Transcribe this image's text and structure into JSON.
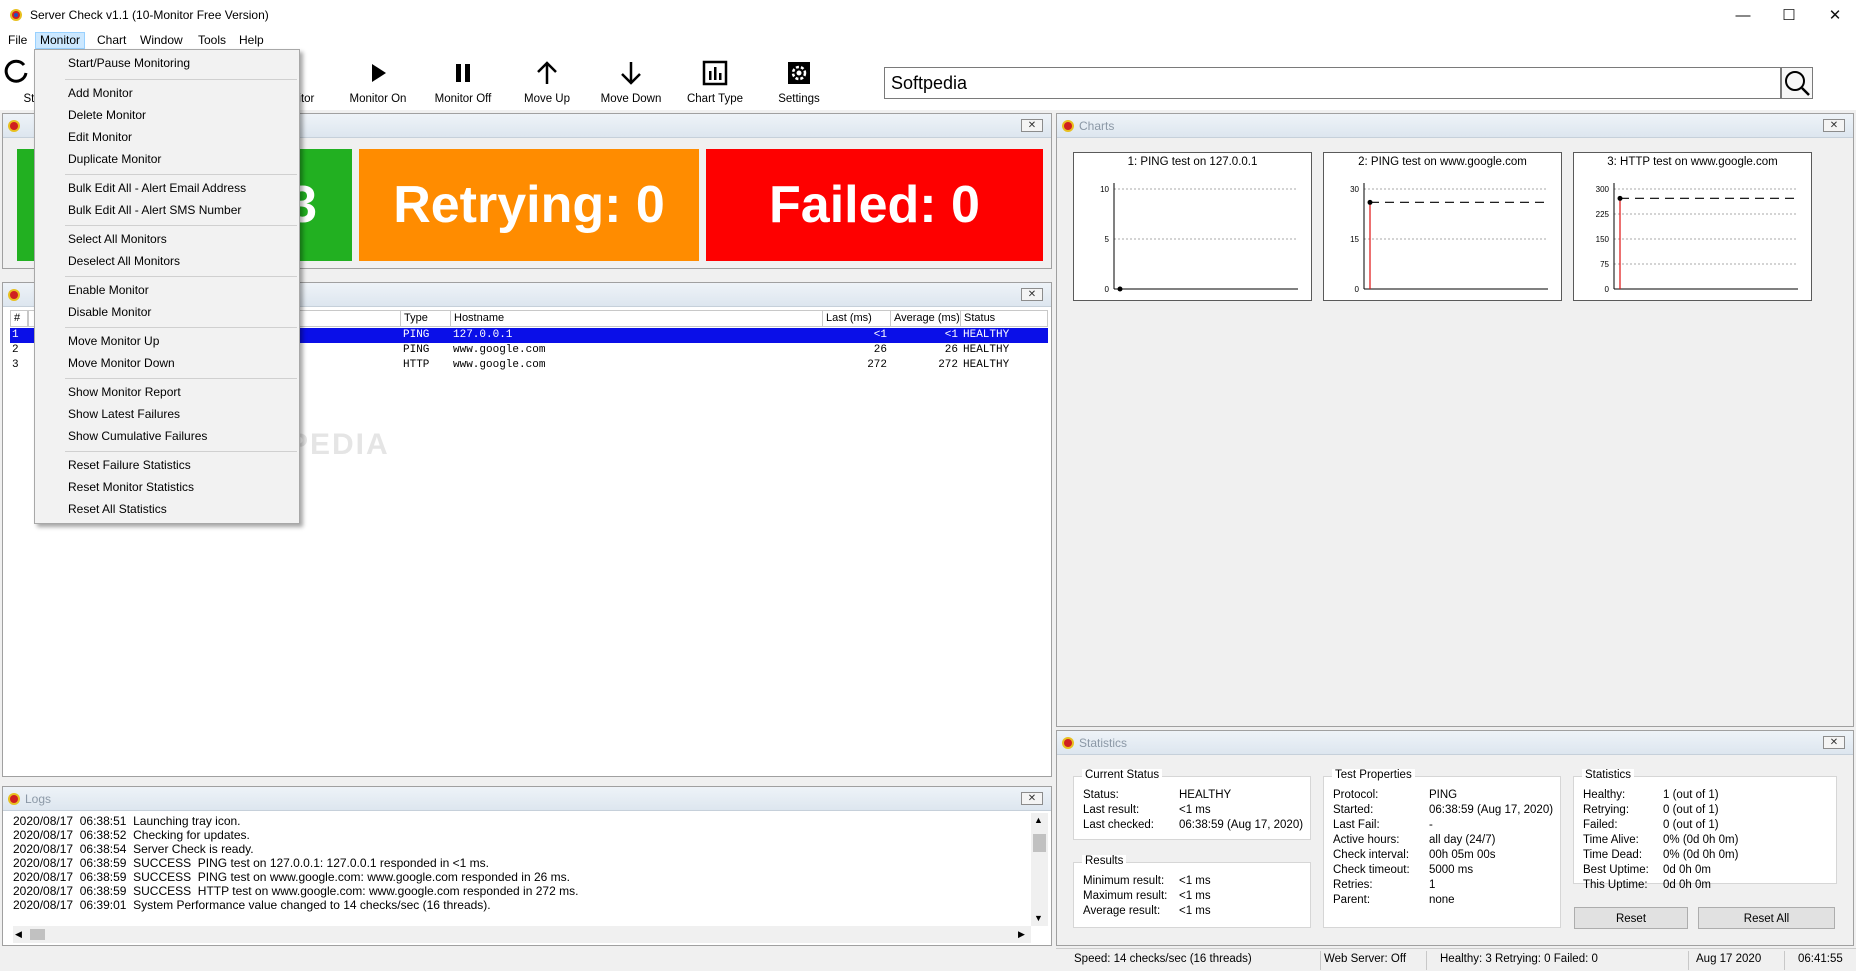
{
  "window": {
    "title": "Server Check v1.1 (10-Monitor Free Version)"
  },
  "menubar": {
    "items": [
      "File",
      "Monitor",
      "Chart",
      "Window",
      "Tools",
      "Help"
    ],
    "active": "Monitor"
  },
  "toolbar": {
    "start_partial": "Star",
    "add_partial": "onitor",
    "buttons": [
      {
        "label": "Monitor On",
        "icon": "play-icon"
      },
      {
        "label": "Monitor Off",
        "icon": "pause-icon"
      },
      {
        "label": "Move Up",
        "icon": "arrow-up-icon"
      },
      {
        "label": "Move Down",
        "icon": "arrow-down-icon"
      },
      {
        "label": "Chart Type",
        "icon": "bar-chart-icon"
      },
      {
        "label": "Settings",
        "icon": "gear-icon"
      }
    ]
  },
  "search": {
    "value": "Softpedia"
  },
  "status_boxes": {
    "healthy_partial": "3",
    "retrying": "Retrying: 0",
    "failed": "Failed: 0",
    "colors": {
      "healthy": "#22b021",
      "retrying": "#ff8c00",
      "failed": "#fe0000"
    }
  },
  "monitor_table": {
    "headers": [
      "#",
      "Type",
      "Hostname",
      "Last (ms)",
      "Average (ms)",
      "Status"
    ],
    "rows": [
      {
        "num": "1",
        "type": "PING",
        "host": "127.0.0.1",
        "last": "<1",
        "avg": "<1",
        "status": "HEALTHY"
      },
      {
        "num": "2",
        "type": "PING",
        "host": "www.google.com",
        "last": "26",
        "avg": "26",
        "status": "HEALTHY"
      },
      {
        "num": "3",
        "type": "HTTP",
        "host": "www.google.com",
        "last": "272",
        "avg": "272",
        "status": "HEALTHY"
      }
    ]
  },
  "dropdown": {
    "groups": [
      [
        "Start/Pause Monitoring"
      ],
      [
        "Add Monitor",
        "Delete Monitor",
        "Edit Monitor",
        "Duplicate Monitor"
      ],
      [
        "Bulk Edit All - Alert Email Address",
        "Bulk Edit All - Alert SMS Number"
      ],
      [
        "Select All Monitors",
        "Deselect All Monitors"
      ],
      [
        "Enable Monitor",
        "Disable Monitor"
      ],
      [
        "Move Monitor Up",
        "Move Monitor Down"
      ],
      [
        "Show Monitor Report",
        "Show Latest Failures",
        "Show Cumulative Failures"
      ],
      [
        "Reset Failure Statistics",
        "Reset Monitor Statistics",
        "Reset All Statistics"
      ]
    ]
  },
  "charts_panel": {
    "title": "Charts"
  },
  "chart_data": [
    {
      "type": "line",
      "title": "1: PING test on 127.0.0.1",
      "yticks": [
        "10",
        "5",
        "0"
      ],
      "ylim": [
        0,
        10
      ],
      "points": [
        0
      ]
    },
    {
      "type": "line",
      "title": "2: PING test on www.google.com",
      "yticks": [
        "30",
        "15",
        "0"
      ],
      "ylim": [
        0,
        30
      ],
      "points": [
        26
      ]
    },
    {
      "type": "line",
      "title": "3: HTTP test on www.google.com",
      "yticks": [
        "300",
        "225",
        "150",
        "75",
        "0"
      ],
      "ylim": [
        0,
        300
      ],
      "points": [
        272
      ]
    }
  ],
  "statistics_panel": {
    "title": "Statistics",
    "current_status": {
      "legend": "Current Status",
      "rows": [
        [
          "Status:",
          "HEALTHY"
        ],
        [
          "Last result:",
          "<1 ms"
        ],
        [
          "Last checked:",
          "06:38:59 (Aug 17, 2020)"
        ]
      ]
    },
    "results": {
      "legend": "Results",
      "rows": [
        [
          "Minimum result:",
          "<1 ms"
        ],
        [
          "Maximum result:",
          "<1 ms"
        ],
        [
          "Average result:",
          "<1 ms"
        ]
      ]
    },
    "test_properties": {
      "legend": "Test Properties",
      "rows": [
        [
          "Protocol:",
          "PING"
        ],
        [
          "Started:",
          "06:38:59 (Aug 17, 2020)"
        ],
        [
          "Last Fail:",
          "-"
        ],
        [
          "Active hours:",
          "all day (24/7)"
        ],
        [
          "Check interval:",
          "00h 05m 00s"
        ],
        [
          "Check timeout:",
          "5000 ms"
        ],
        [
          "Retries:",
          "1"
        ],
        [
          "Parent:",
          "none"
        ]
      ]
    },
    "statistics": {
      "legend": "Statistics",
      "rows": [
        [
          "Healthy:",
          "1 (out of 1)"
        ],
        [
          "Retrying:",
          "0 (out of 1)"
        ],
        [
          "Failed:",
          "0 (out of 1)"
        ],
        [
          "Time Alive:",
          "0% (0d 0h 0m)"
        ],
        [
          "Time Dead:",
          "0% (0d 0h 0m)"
        ],
        [
          "Best Uptime:",
          "0d 0h 0m"
        ],
        [
          "This Uptime:",
          "0d 0h 0m"
        ]
      ]
    },
    "reset_label": "Reset",
    "reset_all_label": "Reset All"
  },
  "logs_panel": {
    "title": "Logs",
    "lines": [
      "2020/08/17  06:38:51  Launching tray icon.",
      "2020/08/17  06:38:52  Checking for updates.",
      "2020/08/17  06:38:54  Server Check is ready.",
      "2020/08/17  06:38:59  SUCCESS  PING test on 127.0.0.1: 127.0.0.1 responded in <1 ms.",
      "2020/08/17  06:38:59  SUCCESS  PING test on www.google.com: www.google.com responded in 26 ms.",
      "2020/08/17  06:38:59  SUCCESS  HTTP test on www.google.com: www.google.com responded in 272 ms.",
      "2020/08/17  06:39:01  System Performance value changed to 14 checks/sec (16 threads)."
    ]
  },
  "statusbar": {
    "speed": "Speed: 14 checks/sec (16 threads)",
    "webserver": "Web Server: Off",
    "counts": "Healthy: 3   Retrying: 0   Failed: 0",
    "date": "Aug 17 2020",
    "time": "06:41:55"
  },
  "watermark": "SOFTPEDIA"
}
